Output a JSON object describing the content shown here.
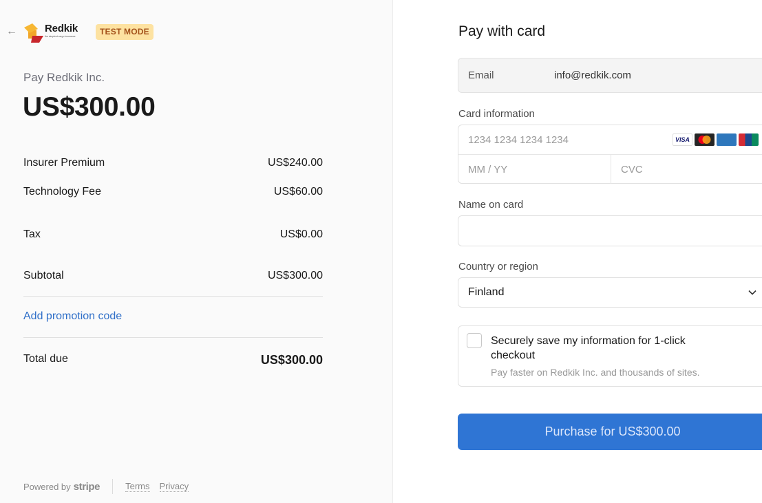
{
  "header": {
    "brand_name": "Redkik",
    "brand_tagline": "the simplest cargo insurance",
    "badge": "TEST MODE"
  },
  "summary": {
    "pay_to": "Pay Redkik Inc.",
    "amount": "US$300.00",
    "items": [
      {
        "label": "Insurer Premium",
        "value": "US$240.00"
      },
      {
        "label": "Technology Fee",
        "value": "US$60.00"
      },
      {
        "label": "Tax",
        "value": "US$0.00"
      },
      {
        "label": "Subtotal",
        "value": "US$300.00"
      }
    ],
    "promo_label": "Add promotion code",
    "total_label": "Total due",
    "total_value": "US$300.00"
  },
  "footer": {
    "powered_by": "Powered by",
    "stripe": "stripe",
    "terms": "Terms",
    "privacy": "Privacy"
  },
  "form": {
    "title": "Pay with card",
    "email_label": "Email",
    "email_value": "info@redkik.com",
    "card_label": "Card information",
    "card_number_placeholder": "1234 1234 1234 1234",
    "expiry_placeholder": "MM / YY",
    "cvc_placeholder": "CVC",
    "brands": [
      "VISA",
      "",
      "",
      ""
    ],
    "name_label": "Name on card",
    "name_value": "",
    "country_label": "Country or region",
    "country_value": "Finland",
    "save_title": "Securely save my information for 1-click checkout",
    "save_subtitle": "Pay faster on Redkik Inc. and thousands of sites.",
    "purchase_label": "Purchase for US$300.00"
  },
  "colors": {
    "accent": "#2f75d4",
    "badge_bg": "#fde2a1",
    "badge_text": "#a4521b",
    "link": "#2f6fc8"
  }
}
